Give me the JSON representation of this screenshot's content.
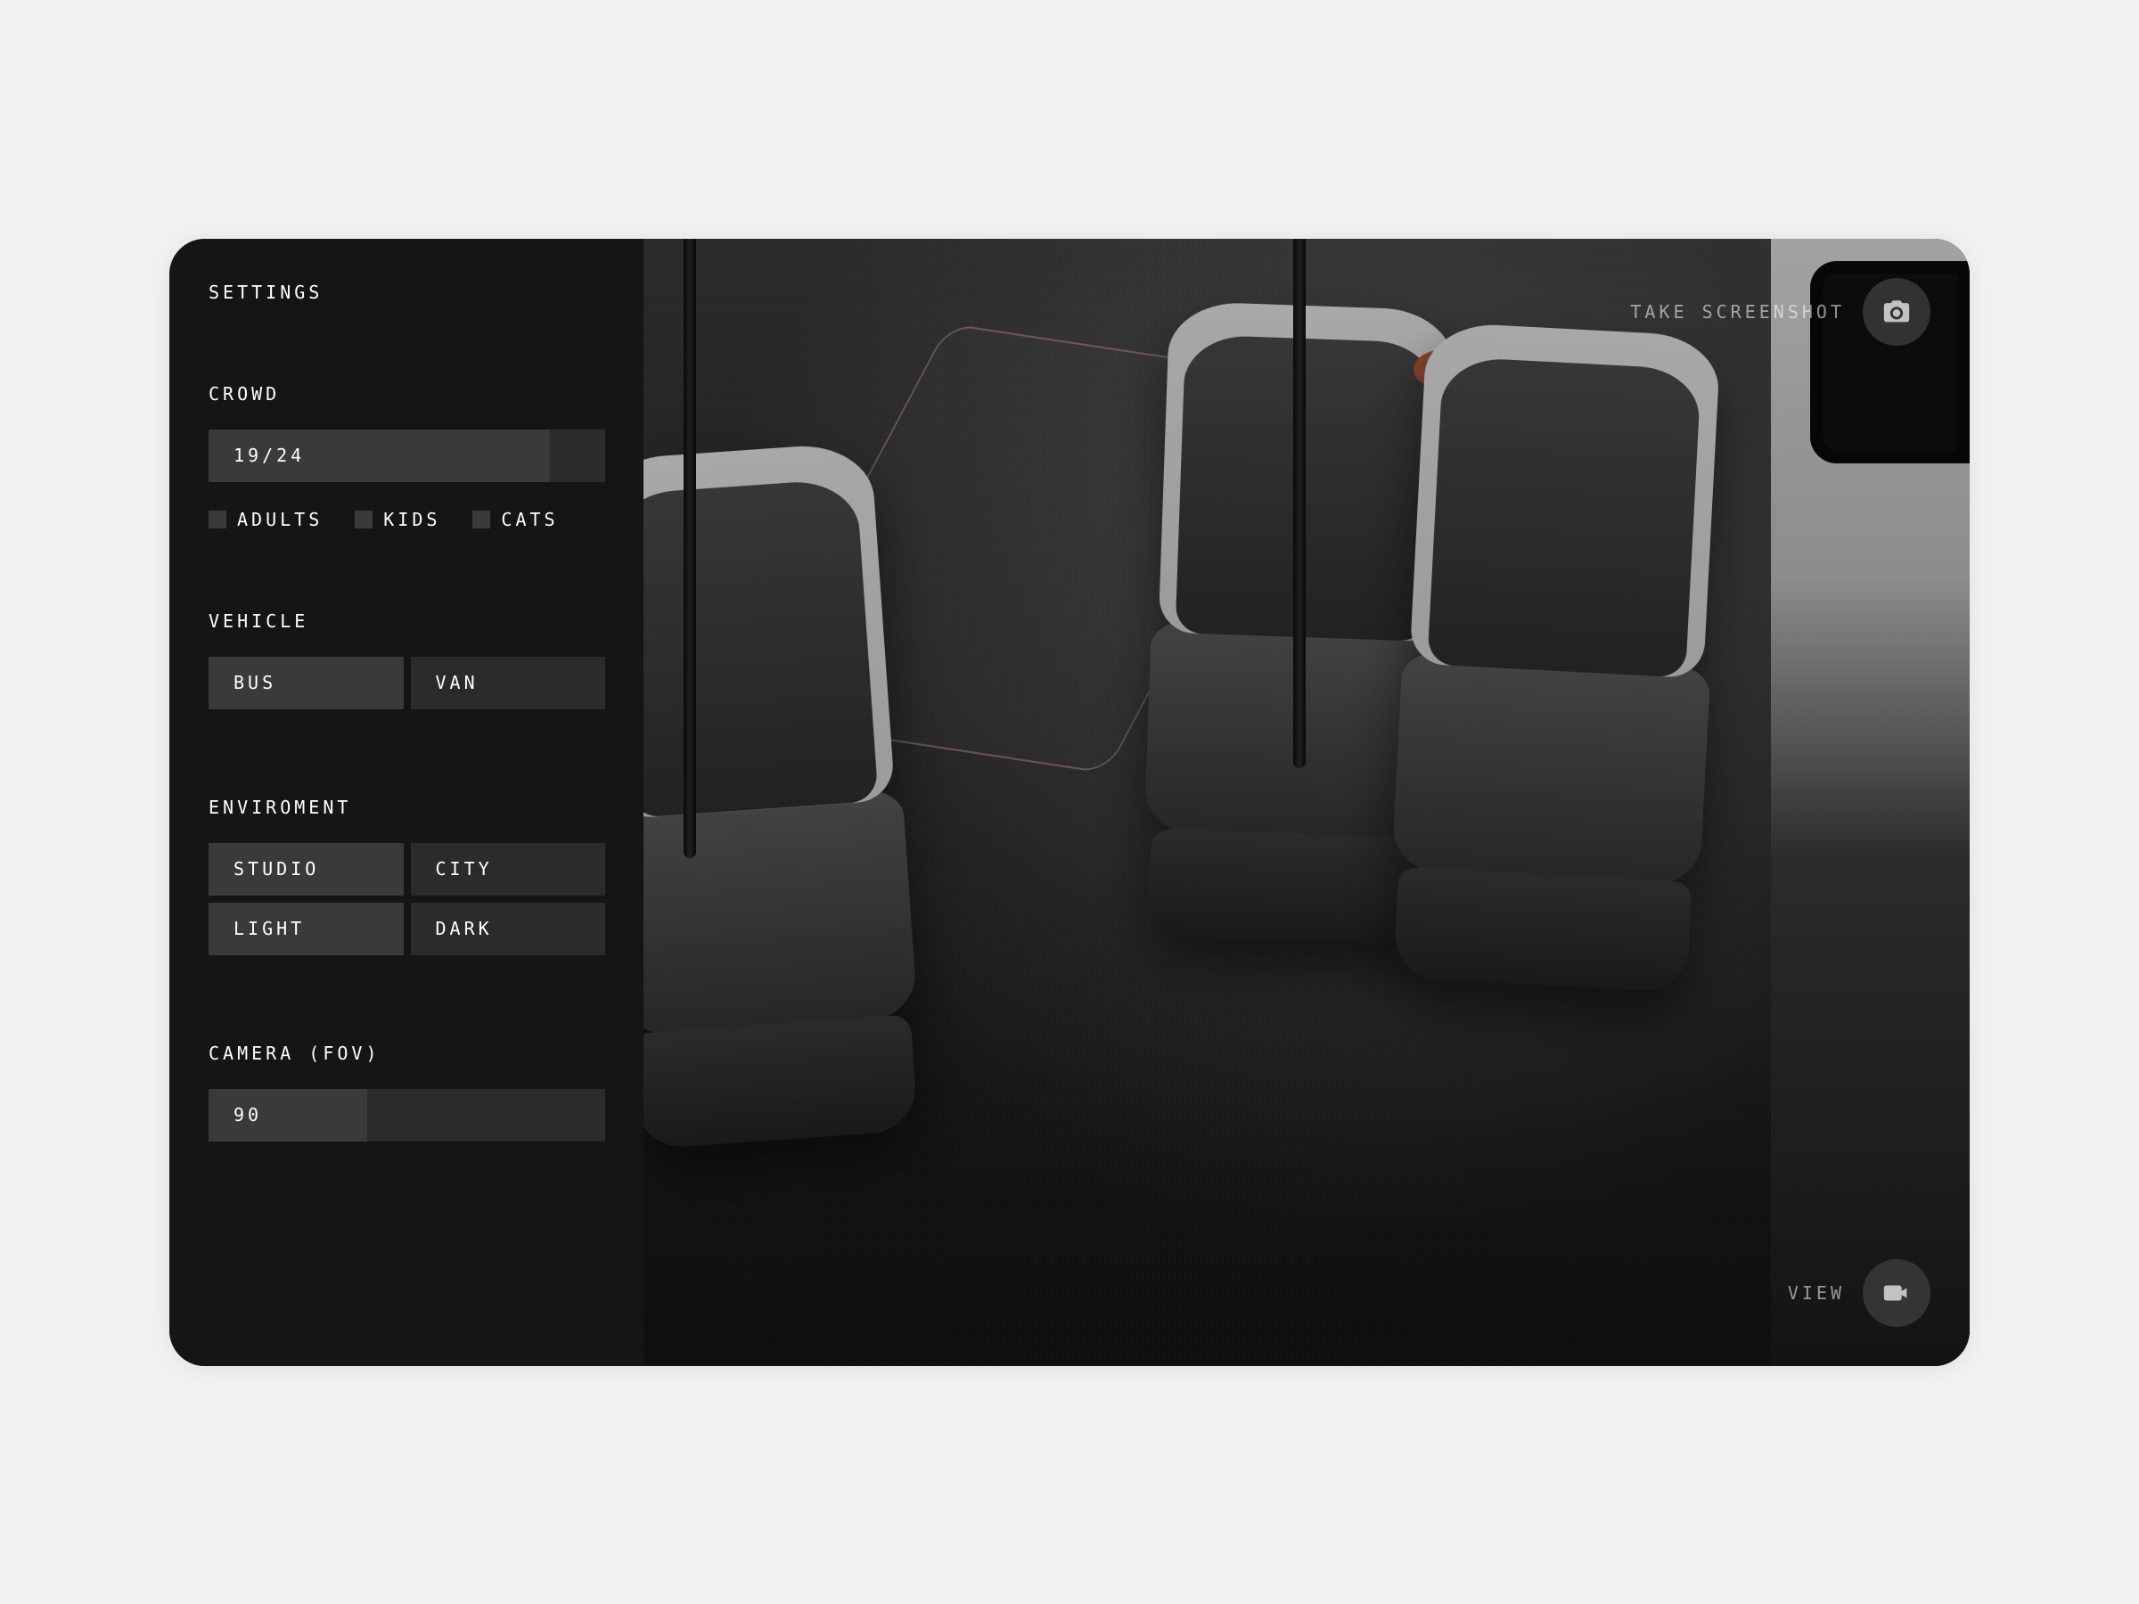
{
  "sidebar": {
    "title": "SETTINGS",
    "crowd": {
      "label": "CROWD",
      "value_text": "19/24",
      "current": 19,
      "max": 24,
      "checks": [
        {
          "label": "ADULTS"
        },
        {
          "label": "KIDS"
        },
        {
          "label": "CATS"
        }
      ]
    },
    "vehicle": {
      "label": "VEHICLE",
      "options": [
        "BUS",
        "VAN"
      ],
      "selected": "BUS"
    },
    "environment": {
      "label": "ENVIROMENT",
      "scene_options": [
        "STUDIO",
        "CITY"
      ],
      "scene_selected": "STUDIO",
      "light_options": [
        "LIGHT",
        "DARK"
      ],
      "light_selected": "LIGHT"
    },
    "camera": {
      "label": "CAMERA (FOV)",
      "value_text": "90",
      "value": 90,
      "min": 0,
      "max": 180
    }
  },
  "hud": {
    "screenshot_label": "TAKE SCREENSHOT",
    "view_label": "VIEW"
  },
  "colors": {
    "bg_page": "#f2f2f2",
    "bg_window": "#151515",
    "control_base": "#2b2b2b",
    "control_active": "#3a3a3a",
    "accent_seat": "#b35b3a"
  }
}
